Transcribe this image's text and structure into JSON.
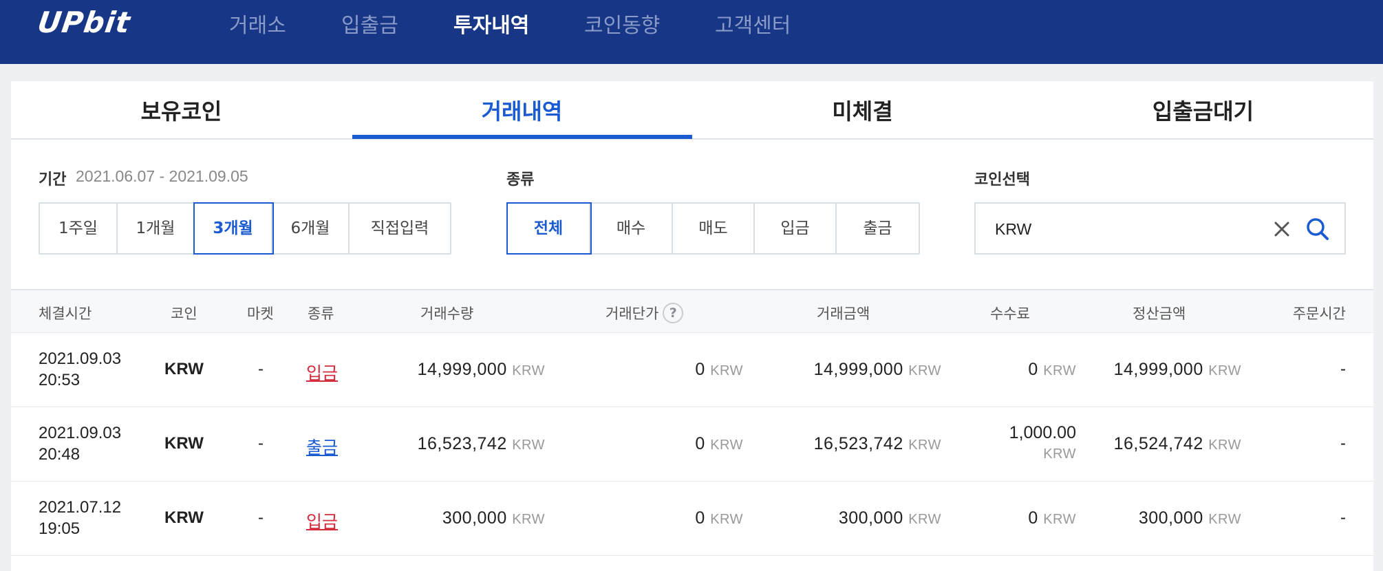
{
  "header": {
    "logo": "UPbit",
    "nav": [
      {
        "label": "거래소",
        "active": false
      },
      {
        "label": "입출금",
        "active": false
      },
      {
        "label": "투자내역",
        "active": true
      },
      {
        "label": "코인동향",
        "active": false
      },
      {
        "label": "고객센터",
        "active": false
      }
    ]
  },
  "tabs": [
    {
      "label": "보유코인",
      "active": false
    },
    {
      "label": "거래내역",
      "active": true
    },
    {
      "label": "미체결",
      "active": false
    },
    {
      "label": "입출금대기",
      "active": false
    }
  ],
  "filters": {
    "period": {
      "label": "기간",
      "range": "2021.06.07 - 2021.09.05",
      "options": [
        "1주일",
        "1개월",
        "3개월",
        "6개월",
        "직접입력"
      ],
      "selected": "3개월"
    },
    "type": {
      "label": "종류",
      "options": [
        "전체",
        "매수",
        "매도",
        "입금",
        "출금"
      ],
      "selected": "전체"
    },
    "coin": {
      "label": "코인선택",
      "value": "KRW",
      "clear_icon": "close-icon",
      "search_icon": "search-icon"
    }
  },
  "table": {
    "headers": {
      "time": "체결시간",
      "coin": "코인",
      "market": "마켓",
      "type": "종류",
      "quantity": "거래수량",
      "price": "거래단가",
      "amount": "거래금액",
      "fee": "수수료",
      "settlement": "정산금액",
      "order_time": "주문시간"
    },
    "price_help": "?",
    "rows": [
      {
        "date": "2021.09.03",
        "time": "20:53",
        "coin": "KRW",
        "market": "-",
        "type": "입금",
        "quantity": "14,999,000",
        "price": "0",
        "amount": "14,999,000",
        "fee": "0",
        "settlement": "14,999,000",
        "order_time": "-",
        "unit": "KRW"
      },
      {
        "date": "2021.09.03",
        "time": "20:48",
        "coin": "KRW",
        "market": "-",
        "type": "출금",
        "quantity": "16,523,742",
        "price": "0",
        "amount": "16,523,742",
        "fee": "1,000.00",
        "settlement": "16,524,742",
        "order_time": "-",
        "unit": "KRW"
      },
      {
        "date": "2021.07.12",
        "time": "19:05",
        "coin": "KRW",
        "market": "-",
        "type": "입금",
        "quantity": "300,000",
        "price": "0",
        "amount": "300,000",
        "fee": "0",
        "settlement": "300,000",
        "order_time": "-",
        "unit": "KRW"
      }
    ]
  },
  "colors": {
    "nav_bg": "#173686",
    "accent": "#1b5bd2",
    "deposit": "#d42a3a",
    "withdraw": "#1b5bd2"
  }
}
